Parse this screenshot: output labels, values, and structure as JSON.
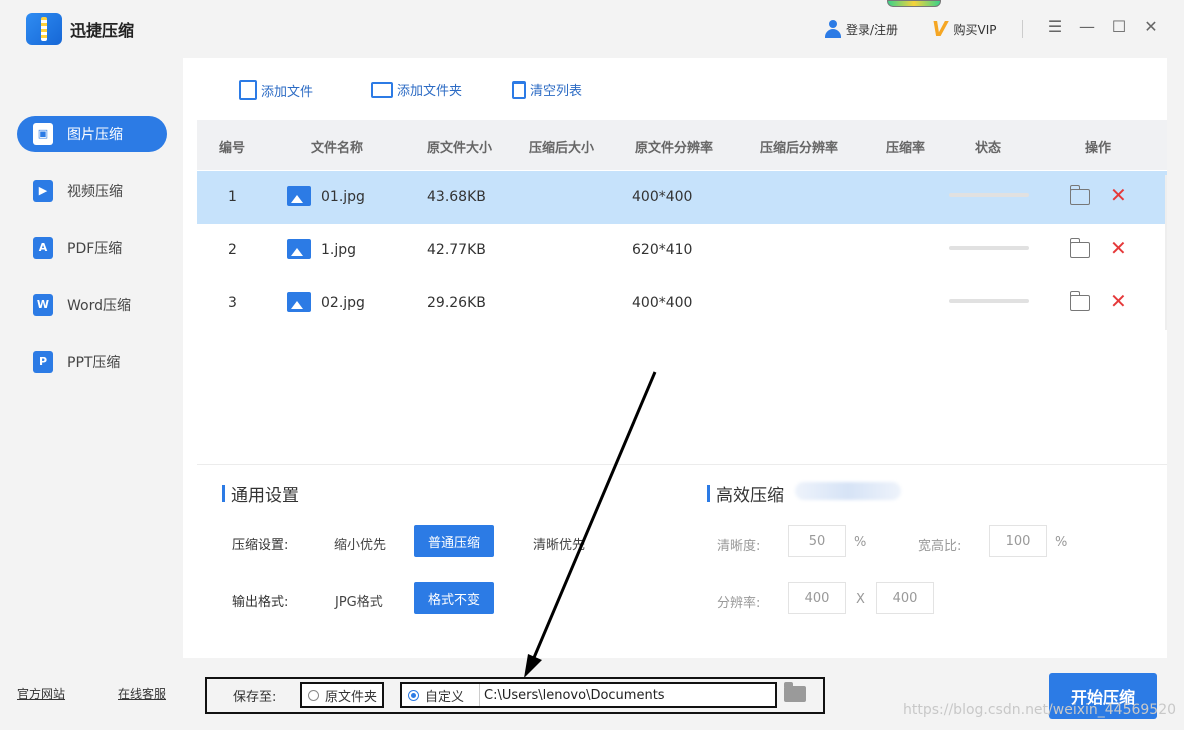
{
  "app": {
    "title": "迅捷压缩"
  },
  "header": {
    "login_label": "登录/注册",
    "vip_label": "购买VIP"
  },
  "window_controls": {
    "menu": "☰",
    "minimize": "—",
    "maximize": "☐",
    "close": "✕"
  },
  "sidebar": {
    "items": [
      {
        "label": "图片压缩",
        "icon": "image-compress-icon",
        "glyph": "▣",
        "active": true
      },
      {
        "label": "视频压缩",
        "icon": "video-compress-icon",
        "glyph": "▶",
        "active": false
      },
      {
        "label": "PDF压缩",
        "icon": "pdf-compress-icon",
        "glyph": "A",
        "active": false
      },
      {
        "label": "Word压缩",
        "icon": "word-compress-icon",
        "glyph": "W",
        "active": false
      },
      {
        "label": "PPT压缩",
        "icon": "ppt-compress-icon",
        "glyph": "P",
        "active": false
      }
    ],
    "links": {
      "website": "官方网站",
      "support": "在线客服"
    }
  },
  "toolbar": {
    "add_file": "添加文件",
    "add_folder": "添加文件夹",
    "clear_list": "清空列表"
  },
  "table": {
    "headers": [
      "编号",
      "文件名称",
      "原文件大小",
      "压缩后大小",
      "原文件分辨率",
      "压缩后分辨率",
      "压缩率",
      "状态",
      "操作"
    ],
    "rows": [
      {
        "no": "1",
        "name": "01.jpg",
        "size": "43.68KB",
        "resolution": "400*400",
        "selected": true
      },
      {
        "no": "2",
        "name": "1.jpg",
        "size": "42.77KB",
        "resolution": "620*410",
        "selected": false
      },
      {
        "no": "3",
        "name": "02.jpg",
        "size": "29.26KB",
        "resolution": "400*400",
        "selected": false
      }
    ]
  },
  "settings": {
    "general_title": "通用设置",
    "compress_label": "压缩设置:",
    "compress_options": [
      "缩小优先",
      "普通压缩",
      "清晰优先"
    ],
    "compress_selected": "普通压缩",
    "format_label": "输出格式:",
    "format_options": [
      "JPG格式",
      "格式不变"
    ],
    "format_selected": "格式不变",
    "efficient_title": "高效压缩",
    "clarity_label": "清晰度:",
    "clarity_value": "50",
    "percent": "%",
    "ratio_label": "宽高比:",
    "ratio_value": "100",
    "resolution_label": "分辨率:",
    "res_w": "400",
    "res_x": "X",
    "res_h": "400"
  },
  "output": {
    "save_label": "保存至:",
    "option_original": "原文件夹",
    "option_custom": "自定义",
    "selected": "custom",
    "path": "C:\\Users\\lenovo\\Documents",
    "start_label": "开始压缩"
  },
  "watermark": "https://blog.csdn.net/weixin_44569520",
  "colors": {
    "accent": "#2c7be5",
    "selected_row": "#c6e2fb",
    "danger": "#e5393a"
  }
}
